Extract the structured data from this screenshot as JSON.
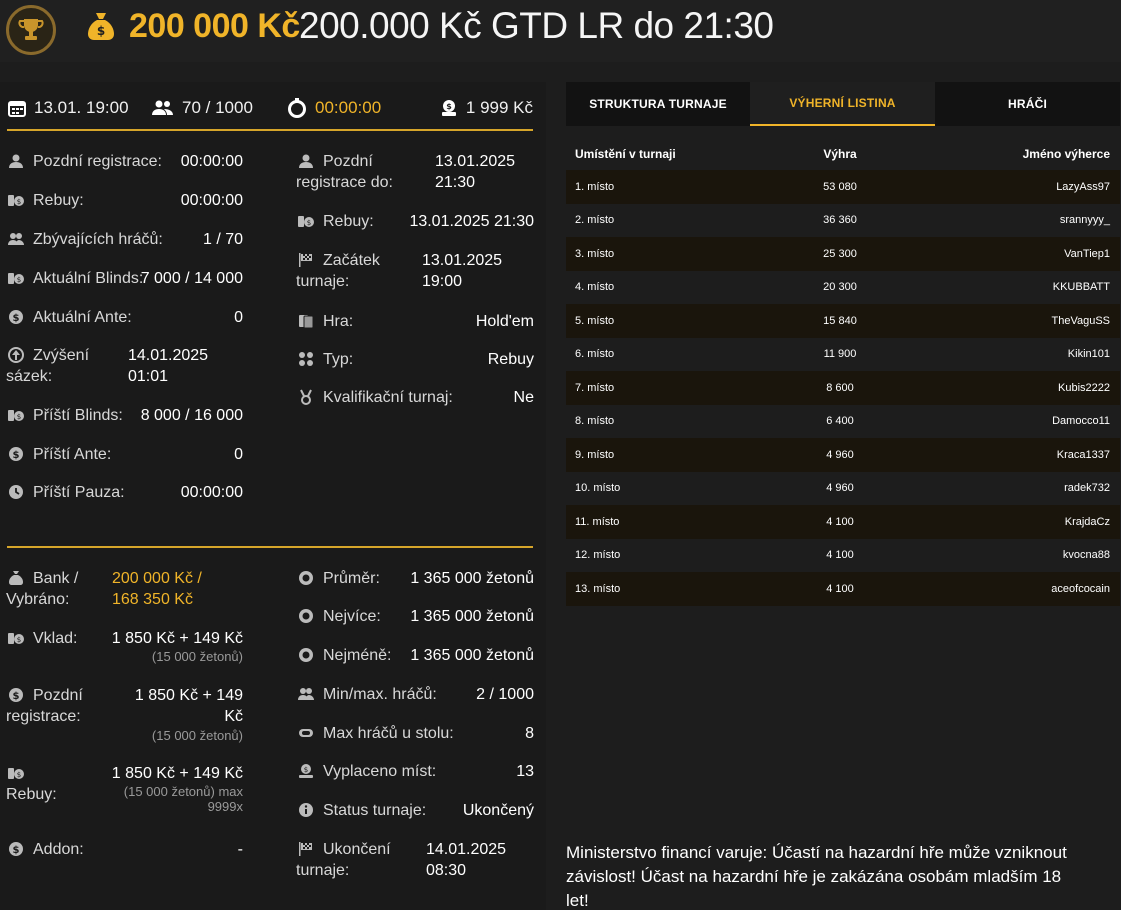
{
  "header": {
    "amount": "200 000 Kč",
    "title": "200.000 Kč GTD LR do 21:30"
  },
  "top": {
    "date": "13.01. 19:00",
    "players": "70 / 1000",
    "timer": "00:00:00",
    "buyin": "1 999 Kč"
  },
  "left": [
    {
      "label": "Pozdní registrace:",
      "value": "00:00:00"
    },
    {
      "label": "Rebuy:",
      "value": "00:00:00"
    },
    {
      "label": "Zbývajících hráčů:",
      "value": "1 / 70"
    },
    {
      "label": "Aktuální Blinds:",
      "value": "7 000 / 14 000"
    },
    {
      "label": "Aktuální Ante:",
      "value": "0"
    },
    {
      "label1": "Zvýšení",
      "label2": "sázek:",
      "value1": "14.01.2025",
      "value2": "01:01"
    },
    {
      "label": "Příští Blinds:",
      "value": "8 000 / 16 000"
    },
    {
      "label": "Příští Ante:",
      "value": "0"
    },
    {
      "label": "Příští Pauza:",
      "value": "00:00:00"
    }
  ],
  "right": [
    {
      "label1": "Pozdní",
      "label2": "registrace do:",
      "value1": "13.01.2025",
      "value2": "21:30"
    },
    {
      "label": "Rebuy:",
      "value": "13.01.2025 21:30"
    },
    {
      "label1": "Začátek",
      "label2": "turnaje:",
      "value1": "13.01.2025",
      "value2": "19:00"
    },
    {
      "label": "Hra:",
      "value": "Hold'em"
    },
    {
      "label": "Typ:",
      "value": "Rebuy"
    },
    {
      "label": "Kvalifikační turnaj:",
      "value": "Ne"
    }
  ],
  "bottom_left": {
    "bank_label1": "Bank /",
    "bank_label2": "Vybráno:",
    "bank_value1": "200 000 Kč /",
    "bank_value2": "168 350 Kč",
    "deposit_label": "Vklad:",
    "deposit_value": "1 850 Kč + 149 Kč",
    "deposit_sub": "(15 000 žetonů)",
    "late_label1": "Pozdní",
    "late_label2": "registrace:",
    "late_value1": "1 850 Kč + 149",
    "late_value2": "Kč",
    "late_sub": "(15 000 žetonů)",
    "rebuy_label": "Rebuy:",
    "rebuy_value": "1 850 Kč + 149 Kč",
    "rebuy_sub1": "(15 000 žetonů) max",
    "rebuy_sub2": "9999x",
    "addon_label": "Addon:",
    "addon_value": "-"
  },
  "bottom_right": [
    {
      "label": "Průměr:",
      "value": "1 365 000 žetonů"
    },
    {
      "label": "Nejvíce:",
      "value": "1 365 000 žetonů"
    },
    {
      "label": "Nejméně:",
      "value": "1 365 000 žetonů"
    },
    {
      "label": "Min/max. hráčů:",
      "value": "2 / 1000"
    },
    {
      "label": "Max hráčů u stolu:",
      "value": "8"
    },
    {
      "label": "Vyplaceno míst:",
      "value": "13"
    },
    {
      "label": "Status turnaje:",
      "value": "Ukončený"
    },
    {
      "label1": "Ukončení",
      "label2": "turnaje:",
      "value1": "14.01.2025",
      "value2": "08:30"
    }
  ],
  "tabs": [
    "STRUKTURA TURNAJE",
    "VÝHERNÍ LISTINA",
    "HRÁČI"
  ],
  "table": {
    "headers": [
      "Umístění v turnaji",
      "Výhra",
      "Jméno výherce"
    ],
    "rows": [
      [
        "1. místo",
        "53 080",
        "LazyAss97"
      ],
      [
        "2. místo",
        "36 360",
        "srannyyy_"
      ],
      [
        "3. místo",
        "25 300",
        "VanTiep1"
      ],
      [
        "4. místo",
        "20 300",
        "KKUBBATT"
      ],
      [
        "5. místo",
        "15 840",
        "TheVaguSS"
      ],
      [
        "6. místo",
        "11 900",
        "Kikin101"
      ],
      [
        "7. místo",
        "8 600",
        "Kubis2222"
      ],
      [
        "8. místo",
        "6 400",
        "Damocco11"
      ],
      [
        "9. místo",
        "4 960",
        "Kraca1337"
      ],
      [
        "10. místo",
        "4 960",
        "radek732"
      ],
      [
        "11. místo",
        "4 100",
        "KrajdaCz"
      ],
      [
        "12. místo",
        "4 100",
        "kvocna88"
      ],
      [
        "13. místo",
        "4 100",
        "aceofcocain"
      ]
    ]
  },
  "warning": "Ministerstvo financí varuje: Účastí na hazardní hře může vzniknout závislost!  Účast na hazardní hře je zakázána osobám mladším 18 let!",
  "colors": {
    "accent": "#f0b429",
    "background": "#1d1d1d",
    "panel": "#1a1a1a",
    "row_alt": "#1a150c"
  }
}
